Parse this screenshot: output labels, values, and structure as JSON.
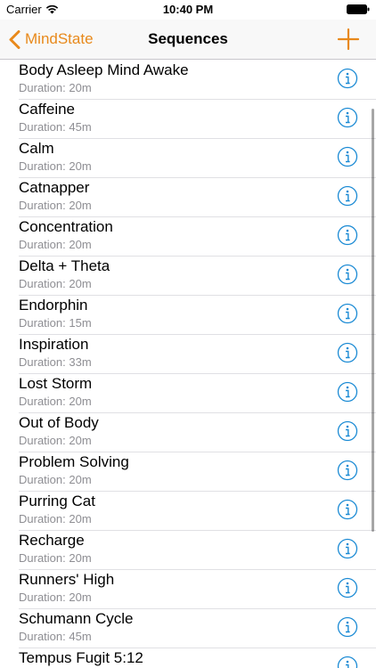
{
  "status_bar": {
    "carrier": "Carrier",
    "time": "10:40 PM"
  },
  "nav": {
    "back_label": "MindState",
    "title": "Sequences"
  },
  "colors": {
    "accent": "#e8891b",
    "info_blue": "#1a8ad4",
    "subtitle_gray": "#8e8e93"
  },
  "sequences": [
    {
      "name": "Body Asleep Mind Awake",
      "duration": "Duration: 20m"
    },
    {
      "name": "Caffeine",
      "duration": "Duration: 45m"
    },
    {
      "name": "Calm",
      "duration": "Duration: 20m"
    },
    {
      "name": "Catnapper",
      "duration": "Duration: 20m"
    },
    {
      "name": "Concentration",
      "duration": "Duration: 20m"
    },
    {
      "name": "Delta + Theta",
      "duration": "Duration: 20m"
    },
    {
      "name": "Endorphin",
      "duration": "Duration: 15m"
    },
    {
      "name": "Inspiration",
      "duration": "Duration: 33m"
    },
    {
      "name": "Lost Storm",
      "duration": "Duration: 20m"
    },
    {
      "name": "Out of Body",
      "duration": "Duration: 20m"
    },
    {
      "name": "Problem Solving",
      "duration": "Duration: 20m"
    },
    {
      "name": "Purring Cat",
      "duration": "Duration: 20m"
    },
    {
      "name": "Recharge",
      "duration": "Duration: 20m"
    },
    {
      "name": "Runners' High",
      "duration": "Duration: 20m"
    },
    {
      "name": "Schumann Cycle",
      "duration": "Duration: 45m"
    },
    {
      "name": "Tempus Fugit 5:12",
      "duration": ""
    }
  ]
}
